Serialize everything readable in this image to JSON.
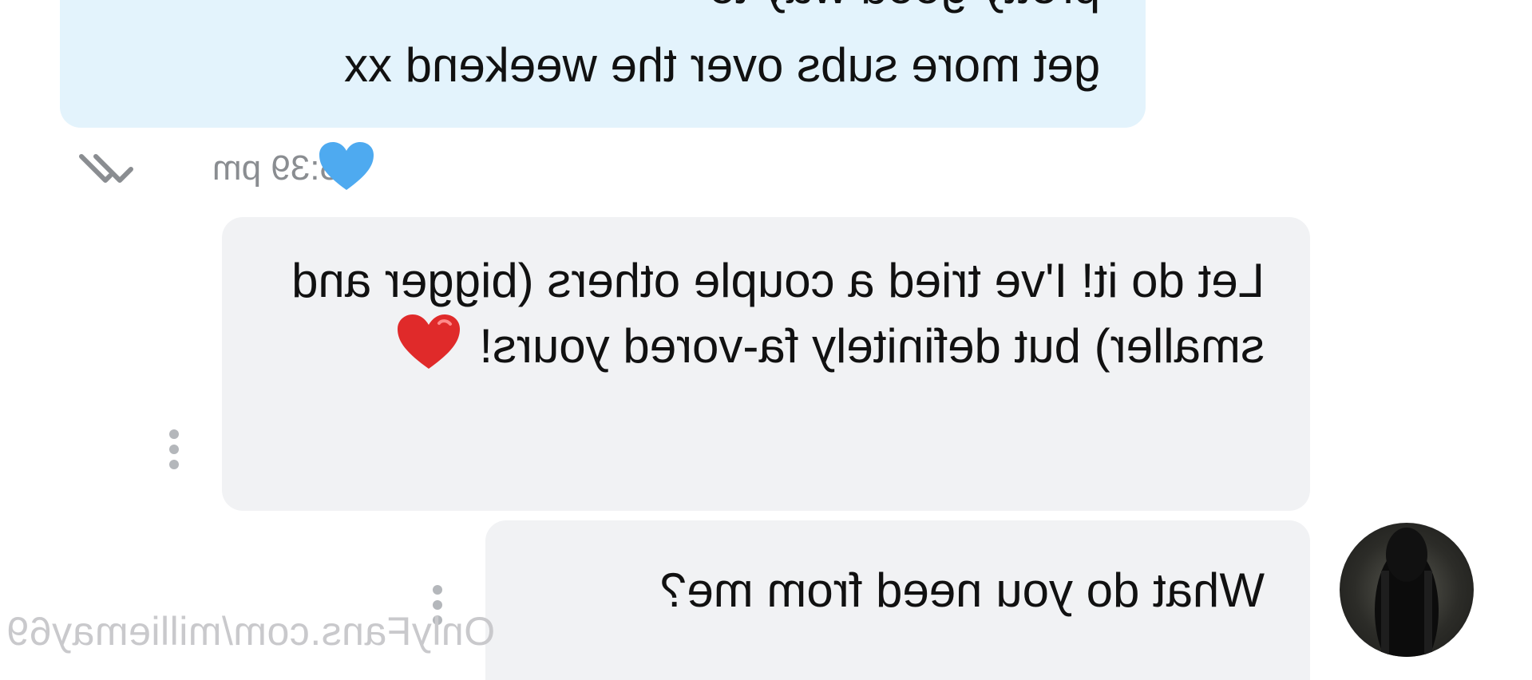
{
  "chat": {
    "outgoing": {
      "line_partial": "pretty good way to",
      "line_last": "get more subs over the weekend xx",
      "time": "5:39 pm"
    },
    "incoming_1": {
      "text": "Let do it! I've tried a couple others (bigger and smaller) but definitely fa-vored yours!"
    },
    "incoming_2": {
      "text": "What do you need from me?"
    }
  },
  "watermark": {
    "text": "OnlyFans.com/milliemay69"
  },
  "colors": {
    "outgoing_bubble": "#e3f3fc",
    "incoming_bubble": "#f1f2f4",
    "like_heart": "#4eaaf0",
    "emoji_heart": "#e02a2a"
  },
  "icons": {
    "like": "heart-icon",
    "read_receipt": "double-check-icon",
    "options": "more-vertical-icon"
  }
}
